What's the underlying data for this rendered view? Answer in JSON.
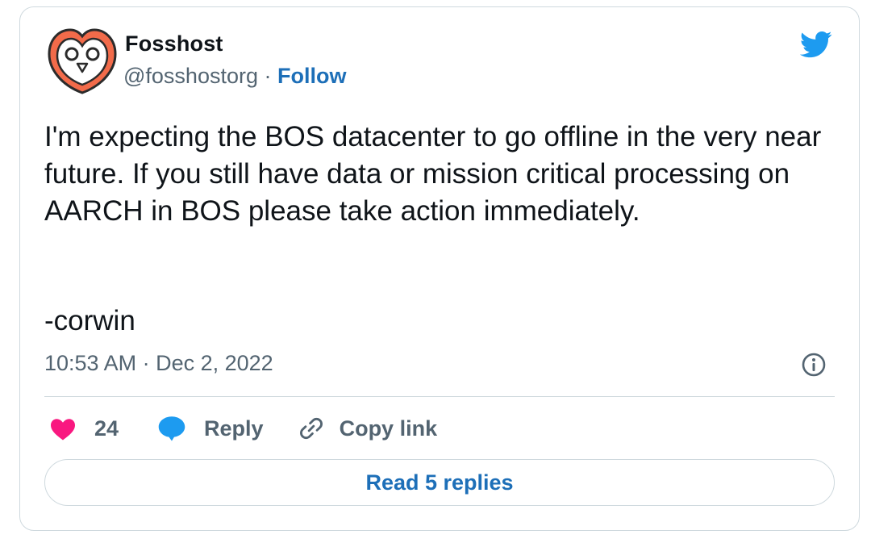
{
  "author": {
    "display_name": "Fosshost",
    "handle": "@fosshostorg",
    "separator": "·",
    "follow_label": "Follow",
    "avatar_icon": "owl-logo-icon",
    "avatar_color": "#f26b4a"
  },
  "brand": {
    "icon": "twitter-bird-icon",
    "color": "#1d9bf0"
  },
  "tweet": {
    "text": "I'm expecting the BOS datacenter to go offline in the very near future.  If you still have data or mission critical processing on AARCH in BOS please take action immediately.",
    "signature": "-corwin",
    "timestamp": "10:53 AM · Dec 2, 2022"
  },
  "actions": {
    "like": {
      "icon": "heart-icon",
      "count": "24",
      "color": "#f91880"
    },
    "reply": {
      "icon": "speech-bubble-icon",
      "label": "Reply",
      "color": "#1d9bf0"
    },
    "copy_link": {
      "icon": "link-icon",
      "label": "Copy link"
    }
  },
  "info_icon": "info-icon",
  "read_replies_label": "Read 5 replies",
  "link_color": "#1d6fb8"
}
